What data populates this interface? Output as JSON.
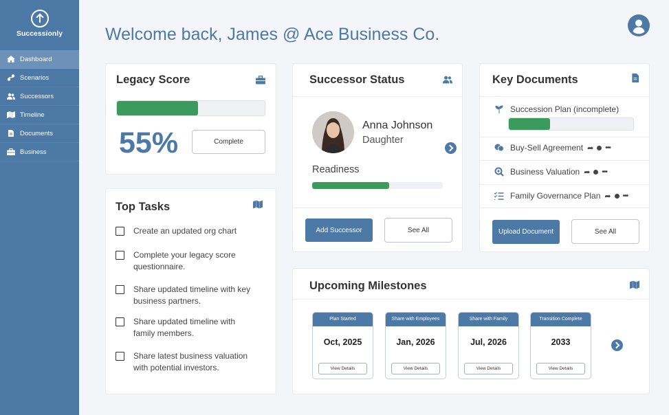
{
  "app": {
    "name": "Successionly"
  },
  "sidebar": {
    "items": [
      {
        "label": "Dashboard",
        "icon": "home-icon"
      },
      {
        "label": "Scenarios",
        "icon": "scenarios-icon"
      },
      {
        "label": "Successors",
        "icon": "users-icon"
      },
      {
        "label": "Timeline",
        "icon": "map-icon"
      },
      {
        "label": "Documents",
        "icon": "document-icon"
      },
      {
        "label": "Business",
        "icon": "briefcase-icon"
      }
    ]
  },
  "header": {
    "welcome": "Welcome back, James @ Ace Business Co."
  },
  "legacy": {
    "title": "Legacy Score",
    "percent_label": "55%",
    "progress": 0.55,
    "button": "Complete"
  },
  "tasks": {
    "title": "Top Tasks",
    "items": [
      {
        "line1": "Create an updated org chart",
        "line2": ""
      },
      {
        "line1": "Complete your legacy score",
        "line2": "questionnaire."
      },
      {
        "line1": "Share updated timeline with key",
        "line2": "business partners."
      },
      {
        "line1": "Share updated timeline with",
        "line2": "family members."
      },
      {
        "line1": "Share latest business valuation",
        "line2": "with potential investors."
      }
    ]
  },
  "successor": {
    "title": "Successor Status",
    "name": "Anna Johnson",
    "relation": "Daughter",
    "readiness_label": "Readiness",
    "readiness": 0.59,
    "add_button": "Add Successor",
    "see_all": "See All"
  },
  "documents": {
    "title": "Key Documents",
    "items": [
      {
        "label": "Succession Plan (incomplete)",
        "icon": "sprout-icon",
        "progress": 0.33
      },
      {
        "label": "Buy-Sell Agreement",
        "icon": "handshake-icon"
      },
      {
        "label": "Business Valuation",
        "icon": "search-dollar-icon"
      },
      {
        "label": "Family Governance Plan",
        "icon": "checklist-icon"
      }
    ],
    "upload_button": "Upload Document",
    "see_all": "See All"
  },
  "milestones": {
    "title": "Upcoming Milestones",
    "items": [
      {
        "label": "Plan Started",
        "date": "Oct, 2025",
        "button": "View Details"
      },
      {
        "label": "Share with Employees",
        "date": "Jan, 2026",
        "button": "View Details"
      },
      {
        "label": "Share with Family",
        "date": "Jul, 2026",
        "button": "View Details"
      },
      {
        "label": "Transition Complete",
        "date": "2033",
        "button": "View Details"
      }
    ]
  },
  "colors": {
    "primary": "#4d79a6",
    "progress": "#3a9b5c",
    "background": "#f3f5f8"
  }
}
